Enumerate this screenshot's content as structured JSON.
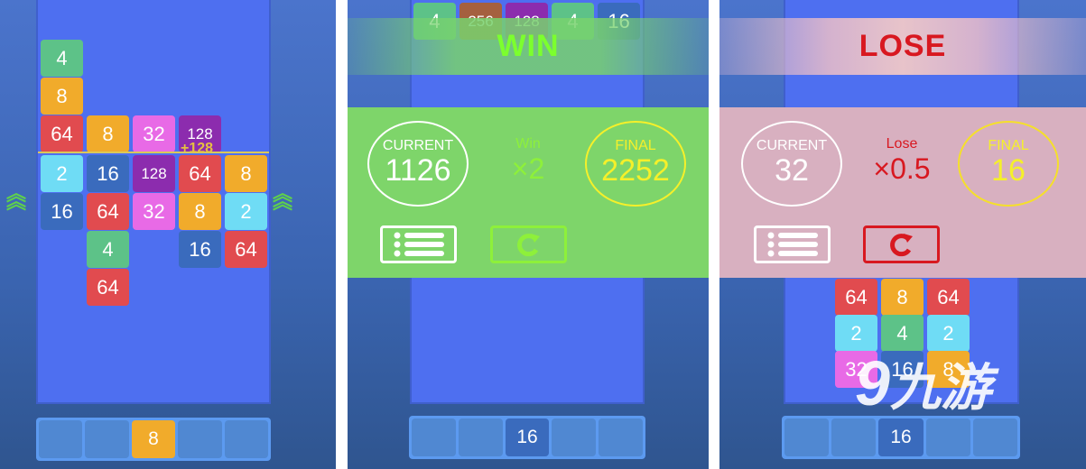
{
  "tile_colors": {
    "2": "#6fdcf5",
    "4": "#5dc288",
    "8": "#f1ab2b",
    "16": "#3a6bbd",
    "32": "#e86ae6",
    "64": "#e14b4f",
    "128": "#8c2cae",
    "256": "#a5603f"
  },
  "panel1": {
    "grid": [
      [
        4
      ],
      [
        8
      ],
      [
        64,
        8,
        32,
        128
      ],
      [
        2,
        16,
        128,
        64,
        8
      ],
      [
        16,
        64,
        32,
        8,
        2
      ],
      [
        null,
        4,
        null,
        16,
        64
      ],
      [
        null,
        64
      ]
    ],
    "merge_popup": "+128",
    "tray": [
      "",
      "",
      "8",
      "",
      ""
    ]
  },
  "panel2": {
    "top_tiles": [
      4,
      256,
      128,
      4,
      16
    ],
    "result_title": "WIN",
    "current_label": "CURRENT",
    "current_value": "1126",
    "multiplier_label": "Win",
    "multiplier_value": "×2",
    "final_label": "FINAL",
    "final_value": "2252",
    "tray": [
      "",
      "",
      "16",
      "",
      ""
    ],
    "accent": "#7ed56a"
  },
  "panel3": {
    "result_title": "LOSE",
    "current_label": "CURRENT",
    "current_value": "32",
    "multiplier_label": "Lose",
    "multiplier_value": "×0.5",
    "final_label": "FINAL",
    "final_value": "16",
    "grid": [
      [
        64,
        8,
        64
      ],
      [
        2,
        4,
        2
      ],
      [
        32,
        16,
        8
      ]
    ],
    "tray": [
      "",
      "",
      "16",
      "",
      ""
    ],
    "accent": "#d8b0c0"
  },
  "watermark": "九游"
}
